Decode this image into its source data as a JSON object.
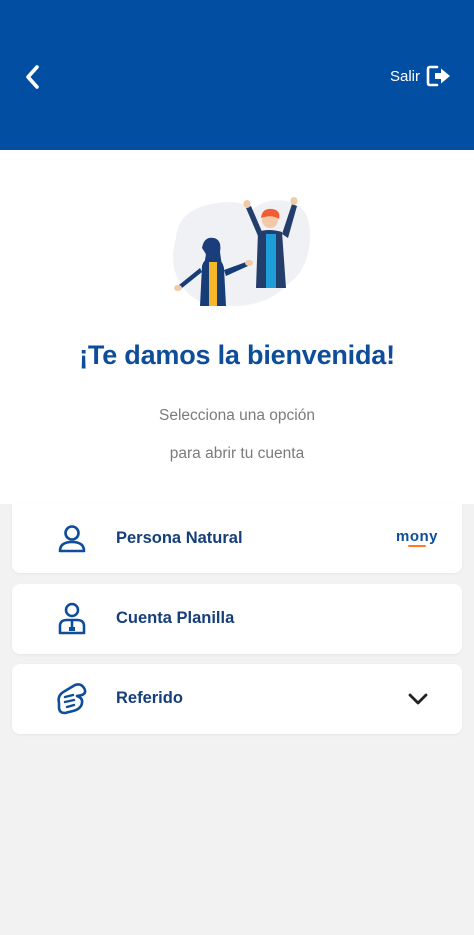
{
  "colors": {
    "brand_blue": "#024ea2",
    "title_blue": "#0d4d9a",
    "label_blue": "#163f7a",
    "accent_orange": "#ff7a22",
    "background": "#f2f2f2"
  },
  "header": {
    "back_icon": "chevron-left-icon",
    "logout_label": "Salir",
    "logout_icon": "logout-icon"
  },
  "welcome": {
    "illustration": "two-people-celebrating-illustration",
    "title": "¡Te damos la bienvenida!",
    "subtitle_line1": "Selecciona una opción",
    "subtitle_line2": "para abrir tu cuenta"
  },
  "options": [
    {
      "label": "Persona Natural",
      "icon": "person-icon",
      "badge": "mony"
    },
    {
      "label": "Cuenta Planilla",
      "icon": "payroll-person-icon"
    },
    {
      "label": "Referido",
      "icon": "handshake-icon",
      "trailing_icon": "chevron-down-icon"
    }
  ]
}
